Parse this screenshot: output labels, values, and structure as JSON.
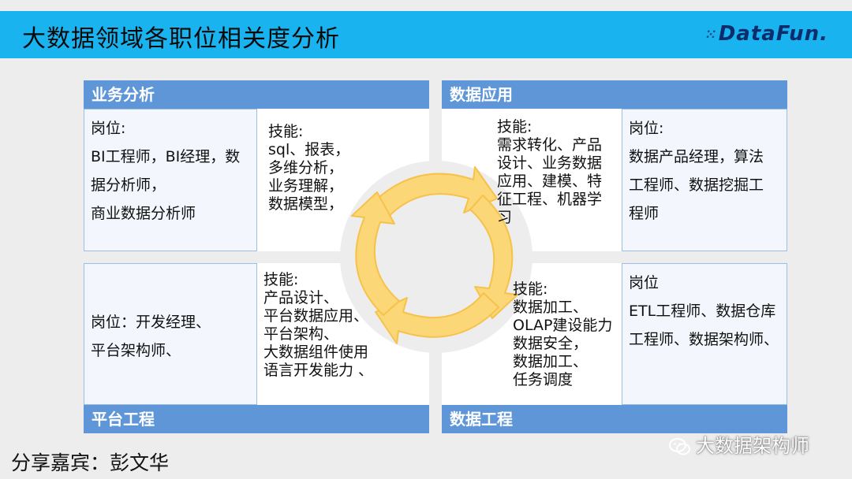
{
  "title": "大数据领域各职位相关度分析",
  "logo": "DataFun.",
  "quadrants": {
    "business_analysis": {
      "header": "业务分析",
      "roles": [
        "岗位:",
        "BI工程师，BI经理，数",
        "据分析师，",
        "商业数据分析师"
      ],
      "skills": [
        "技能:",
        "sql、报表，",
        "多维分析，",
        "业务理解，",
        "数据模型，"
      ]
    },
    "data_application": {
      "header": "数据应用",
      "skills": [
        "技能:",
        "需求转化、产品",
        "设计、业务数据",
        "应用、建模、特",
        "征工程、机器学",
        "习"
      ],
      "roles": [
        "岗位:",
        "数据产品经理，算法",
        "工程师、数据挖掘工",
        "程师"
      ]
    },
    "platform_engineering": {
      "header": "平台工程",
      "roles": [
        "岗位：开发经理、",
        "平台架构师、"
      ],
      "skills": [
        "技能:",
        "产品设计、",
        "平台数据应用、",
        "平台架构、",
        "大数据组件使用",
        "语言开发能力 、"
      ]
    },
    "data_engineering": {
      "header": "数据工程",
      "skills": [
        "技能:",
        "数据加工、",
        "OLAP建设能力",
        "数据安全，",
        "数据加工、",
        "任务调度"
      ],
      "roles": [
        "岗位",
        "ETL工程师、数据仓库",
        "工程师、数据架构师、"
      ]
    }
  },
  "footer": "分享嘉宾：彭文华",
  "watermark": "大数据架构师",
  "icons": {
    "cycle": "circular-arrows-icon",
    "wechat": "wechat-icon"
  },
  "colors": {
    "title_bar": "#19b3f0",
    "section_header": "#5f96d8",
    "cycle_arrows": "#fbd777"
  }
}
